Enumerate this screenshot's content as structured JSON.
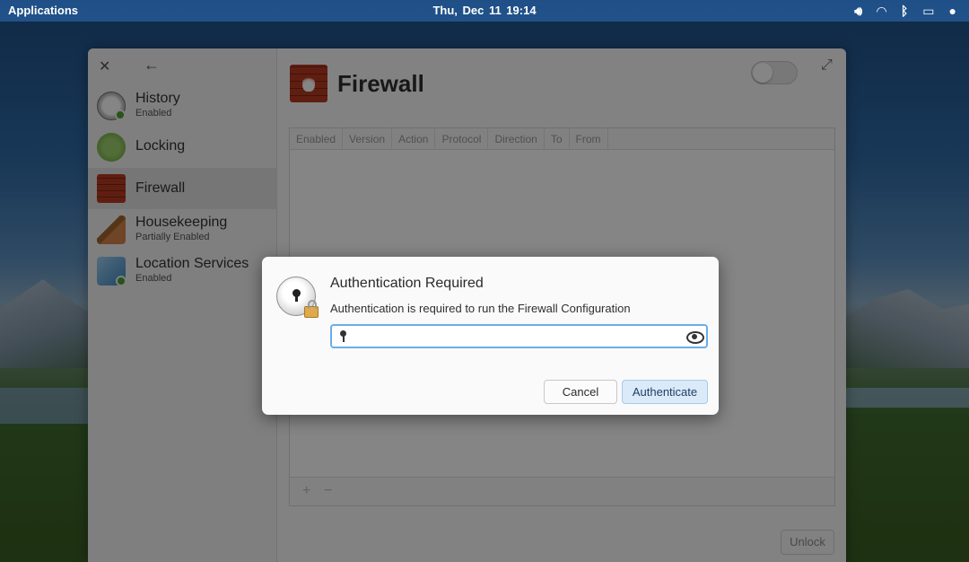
{
  "topbar": {
    "applications": "Applications",
    "datetime": "Thu, Dec 11   19:14",
    "tray_icons": [
      "volume-icon",
      "wifi-icon",
      "bluetooth-icon",
      "battery-icon",
      "notification-icon"
    ]
  },
  "settings": {
    "sidebar": {
      "items": [
        {
          "title": "History",
          "subtitle": "Enabled",
          "icon": "history-icon"
        },
        {
          "title": "Locking",
          "subtitle": "",
          "icon": "lock-icon"
        },
        {
          "title": "Firewall",
          "subtitle": "",
          "icon": "firewall-icon"
        },
        {
          "title": "Housekeeping",
          "subtitle": "Partially Enabled",
          "icon": "broom-icon"
        },
        {
          "title": "Location Services",
          "subtitle": "Enabled",
          "icon": "location-icon"
        }
      ]
    },
    "page_title": "Firewall",
    "table_columns": [
      "Enabled",
      "Version",
      "Action",
      "Protocol",
      "Direction",
      "To",
      "From"
    ],
    "footer_add": "+",
    "footer_remove": "−",
    "unlock_label": "Unlock"
  },
  "dialog": {
    "title": "Authentication Required",
    "message": "Authentication is required to run the Firewall Configuration",
    "password_value": "",
    "cancel_label": "Cancel",
    "authenticate_label": "Authenticate"
  },
  "colors": {
    "accent": "#6aaee6",
    "default_button_bg": "#dbeaf8",
    "enabled_badge": "#4ea22f"
  }
}
